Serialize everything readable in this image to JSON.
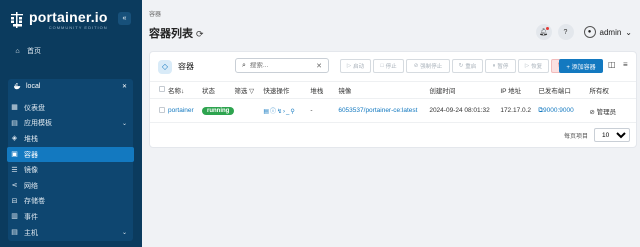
{
  "brand": {
    "name": "portainer.io",
    "edition": "COMMUNITY EDITION"
  },
  "sidebar": {
    "home_label": "首页",
    "environment": "local",
    "items": [
      {
        "label": "仪表盘",
        "icon": "dashboard-icon"
      },
      {
        "label": "应用模板",
        "icon": "template-icon",
        "has_children": true
      },
      {
        "label": "堆栈",
        "icon": "stack-icon"
      },
      {
        "label": "容器",
        "icon": "container-icon",
        "active": true
      },
      {
        "label": "镜像",
        "icon": "image-icon"
      },
      {
        "label": "网络",
        "icon": "network-icon"
      },
      {
        "label": "存储卷",
        "icon": "volume-icon"
      },
      {
        "label": "事件",
        "icon": "events-icon"
      },
      {
        "label": "主机",
        "icon": "host-icon",
        "has_children": true
      }
    ]
  },
  "header": {
    "breadcrumb": "容器",
    "title": "容器列表",
    "user": "admin"
  },
  "card": {
    "title": "容器",
    "search_placeholder": "搜索...",
    "actions": {
      "start": "启动",
      "stop": "停止",
      "kill": "强制停止",
      "restart": "重启",
      "pause": "暂停",
      "resume": "恢复",
      "remove": "删除",
      "add": "+ 添加容器"
    },
    "columns": {
      "name": "名称↓",
      "state": "状态",
      "filter": "筛选",
      "quick": "快速操作",
      "stack": "堆栈",
      "image": "镜像",
      "created": "创建时间",
      "ip": "IP 地址",
      "ports": "已发布端口",
      "owner": "所有权"
    },
    "rows": [
      {
        "name": "portainer",
        "state": "running",
        "stack": "-",
        "image": "6053537/portainer-ce:latest",
        "created": "2024-09-24 08:01:32",
        "ip": "172.17.0.2",
        "ports": "9000:9000",
        "owner": "管理员"
      }
    ],
    "pager": {
      "label": "每页项目",
      "value": "10"
    }
  },
  "colors": {
    "sidebar": "#0b3b5e",
    "accent": "#1379c0",
    "running": "#2ea44f",
    "danger": "#e07a7a"
  }
}
